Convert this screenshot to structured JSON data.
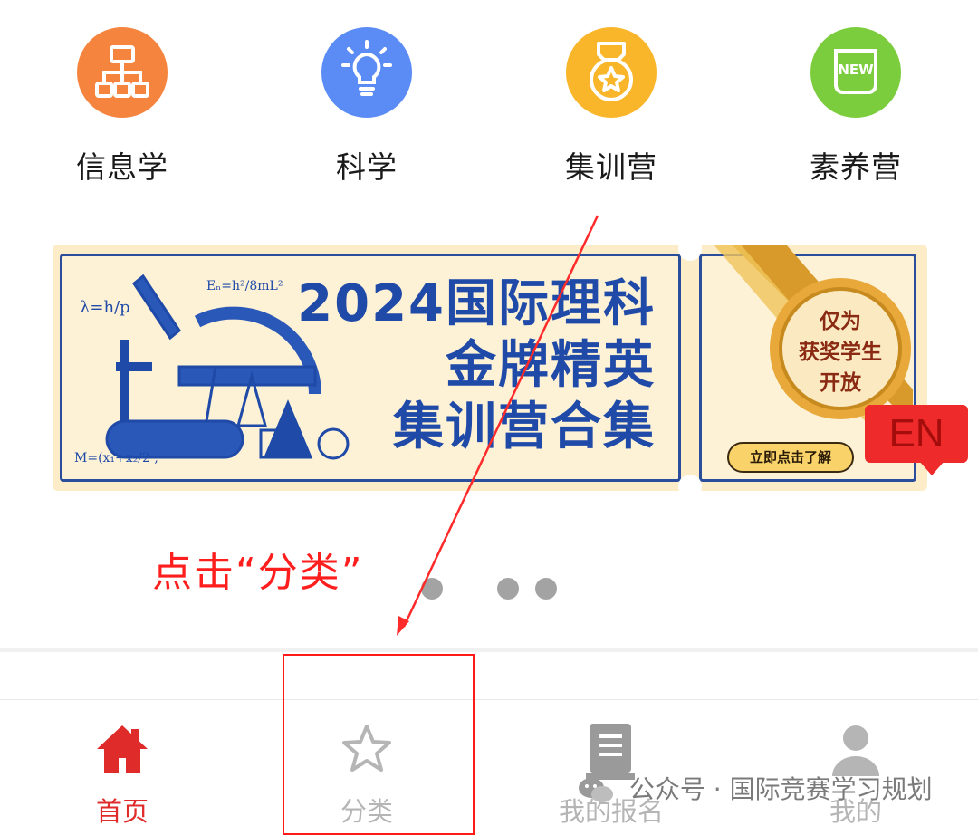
{
  "categories": [
    {
      "label": "信息学",
      "icon": "hierarchy-icon",
      "color": "#f5843f"
    },
    {
      "label": "科学",
      "icon": "lightbulb-icon",
      "color": "#5b8bf5"
    },
    {
      "label": "集训营",
      "icon": "medal-icon",
      "color": "#f9b62a"
    },
    {
      "label": "素养营",
      "icon": "new-badge-icon",
      "color": "#7ccd3d",
      "icon_text": "NEW"
    }
  ],
  "banner": {
    "headline": [
      "2024国际理科",
      "金牌精英",
      "集训营合集"
    ],
    "seal_text": [
      "仅为",
      "获奖学生",
      "开放"
    ],
    "cta": "立即点击了解",
    "lang_badge": "EN",
    "colors": {
      "bg": "#fcecc8",
      "headline": "#1f4aa8",
      "badge": "#ef2a2a"
    }
  },
  "annotation": {
    "text": "点击“分类”",
    "color": "#ff1e1e"
  },
  "carousel": {
    "dots": 3
  },
  "tabbar": {
    "tabs": [
      {
        "label": "首页",
        "icon": "home-icon",
        "active": true,
        "color": "#e02b2b"
      },
      {
        "label": "分类",
        "icon": "star-icon",
        "active": false,
        "color": "#b5b5b5"
      },
      {
        "label": "我的报名",
        "icon": "document-icon",
        "active": false,
        "color": "#b5b5b5"
      },
      {
        "label": "我的",
        "icon": "user-icon",
        "active": false,
        "color": "#b5b5b5"
      }
    ]
  },
  "watermark": {
    "text": "公众号 · 国际竞赛学习规划"
  }
}
